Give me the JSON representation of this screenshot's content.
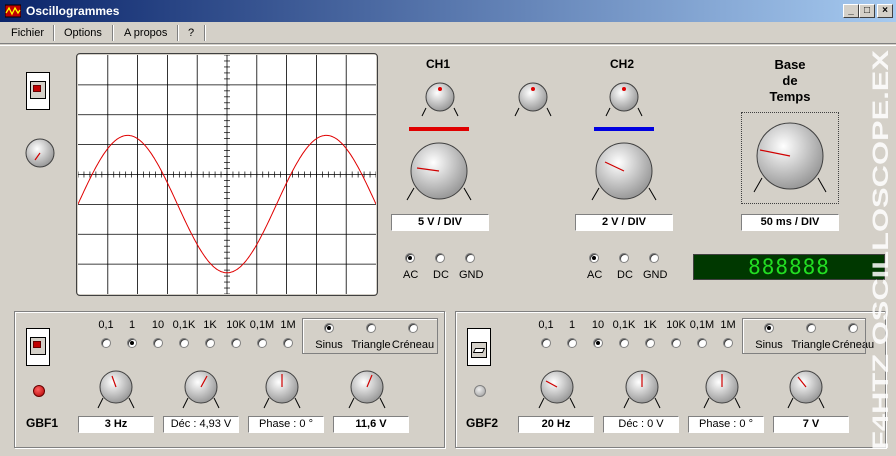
{
  "window": {
    "title": "Oscillogrammes",
    "controls": [
      "_",
      "□",
      "×"
    ]
  },
  "menu": {
    "items": [
      "Fichier",
      "Options",
      "A propos",
      "?"
    ]
  },
  "ch1": {
    "title": "CH1",
    "color": "#e00000",
    "scale": "5 V / DIV",
    "coupling": [
      "AC",
      "DC",
      "GND"
    ],
    "selected": "AC"
  },
  "ch2": {
    "title": "CH2",
    "color": "#0000e0",
    "scale": "2 V / DIV",
    "coupling": [
      "AC",
      "DC",
      "GND"
    ],
    "selected": "AC"
  },
  "timebase": {
    "title_lines": [
      "Base",
      "de",
      "Temps"
    ],
    "scale": "50 ms / DIV"
  },
  "frequency_display": {
    "text": "888888",
    "color": "#22dd22"
  },
  "trace": {
    "color": "#e00000",
    "cycles_shown": 1.5,
    "amplitude_div": 2.3,
    "offset_div": -0.99
  },
  "gbf1": {
    "name": "GBF1",
    "ranges": [
      "0,1",
      "1",
      "10",
      "0,1K",
      "1K",
      "10K",
      "0,1M",
      "1M"
    ],
    "selected_range": "1",
    "waveforms": [
      "Sinus",
      "Triangle",
      "Créneau"
    ],
    "selected_waveform": "Sinus",
    "led_on": true,
    "frequency": "3 Hz",
    "offset": "Déc : 4,93 V",
    "phase": "Phase : 0 °",
    "amplitude": "11,6 V"
  },
  "gbf2": {
    "name": "GBF2",
    "ranges": [
      "0,1",
      "1",
      "10",
      "0,1K",
      "1K",
      "10K",
      "0,1M",
      "1M"
    ],
    "selected_range": "10",
    "waveforms": [
      "Sinus",
      "Triangle",
      "Créneau"
    ],
    "selected_waveform": "Sinus",
    "led_on": false,
    "frequency": "20 Hz",
    "offset": "Déc : 0 V",
    "phase": "Phase : 0 °",
    "amplitude": "7 V"
  },
  "watermark": "F4HTZ  OSCILLOSCOPE.EX"
}
